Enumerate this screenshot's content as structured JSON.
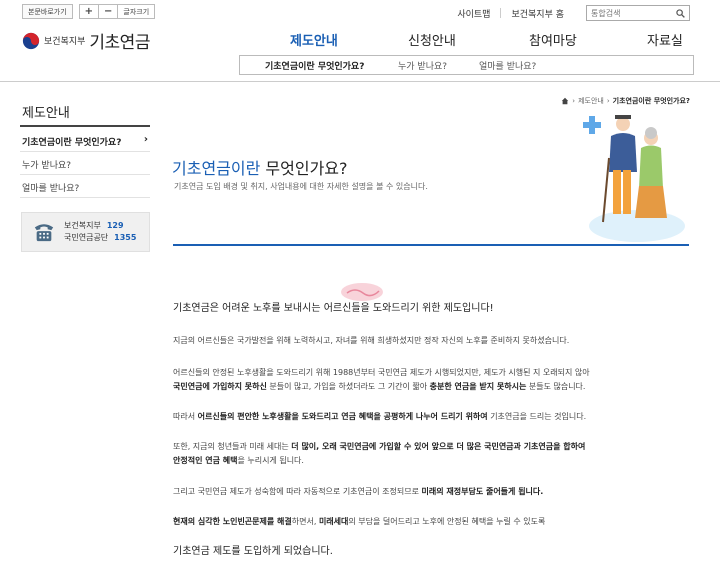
{
  "util": {
    "text_only_label": "본문바로가기",
    "font_plus": "+",
    "font_minus": "−",
    "font_label": "글자크기",
    "sitemap": "사이트맵",
    "ministry_home": "보건복지부 홈",
    "search_placeholder": "통합검색"
  },
  "logo": {
    "ministry": "보건복지부",
    "brand": "기초연금"
  },
  "gnb": [
    {
      "label": "제도안내",
      "active": true
    },
    {
      "label": "신청안내",
      "active": false
    },
    {
      "label": "참여마당",
      "active": false
    },
    {
      "label": "자료실",
      "active": false
    }
  ],
  "subnav": [
    {
      "label": "기초연금이란 무엇인가요?",
      "active": true
    },
    {
      "label": "누가 받나요?",
      "active": false
    },
    {
      "label": "얼마를 받나요?",
      "active": false
    }
  ],
  "lnb": {
    "title": "제도안내",
    "items": [
      {
        "label": "기초연금이란 무엇인가요?",
        "active": true
      },
      {
        "label": "누가 받나요?",
        "active": false
      },
      {
        "label": "얼마를 받나요?",
        "active": false
      }
    ]
  },
  "contact": [
    {
      "org": "보건복지부",
      "num": "129"
    },
    {
      "org": "국민연금공단",
      "num": "1355"
    }
  ],
  "breadcrumb": {
    "parent": "제도안내",
    "current": "기초연금이란 무엇인가요?"
  },
  "page": {
    "title_blue": "기초연금이란",
    "title_rest": " 무엇인가요?",
    "desc": "기초연금 도입 배경 및 취지, 사업내용에 대한 자세한 설명을 볼 수 있습니다."
  },
  "body": {
    "lead": "기초연금은 어려운 노후를 보내시는 어르신들을 도와드리기 위한 제도입니다!",
    "p1": "지금의 어르신들은 국가발전을 위해 노력하시고, 자녀를 위해 희생하셨지만 정작 자신의 노후를 준비하지 못하셨습니다.",
    "p2a": "어르신들의 안정된 노후생활을 도와드리기 위해 1988년부터 국민연금 제도가 시행되었지만, 제도가 시행된 지 오래되지 않아",
    "p2b_1": "국민연금에 가입하지 못하신",
    "p2b_2": " 분들이 많고, 가입을 하셨더라도 그 기간이 짧아 ",
    "p2b_3": "충분한 연금을 받지 못하시는",
    "p2b_4": " 분들도 많습니다.",
    "p3_1": "따라서 ",
    "p3_2": "어르신들의 편안한 노후생활을 도와드리고 연금 혜택을 공평하게 나누어 드리기 위하여",
    "p3_3": " 기초연금을 드리는 것입니다.",
    "p4a_1": "또한, 지금의 청년들과 미래 세대는 ",
    "p4a_2": "더 많이, 오래 국민연금에 가입할 수 있어 앞으로 더 많은 국민연금과 기초연금을 합하여",
    "p4b_1": "안정적인 연금 혜택",
    "p4b_2": "을 누리시게 됩니다.",
    "p5_1": "그리고 국민연금 제도가 성숙함에 따라 자동적으로 기초연금이 조정되므로 ",
    "p5_2": "미래의 재정부담도 줄어들게 됩니다.",
    "p6_1": "현재의 심각한 노인빈곤문제를 해결",
    "p6_2": "하면서, ",
    "p6_3": "미래세대",
    "p6_4": "의 부담을 덜어드리고 노후에 안정된 혜택을 누릴 수 있도록",
    "closing": "기초연금 제도를 도입하게 되었습니다."
  },
  "colors": {
    "accent": "#1a5fb4",
    "stamp": "#f4b6c2"
  }
}
